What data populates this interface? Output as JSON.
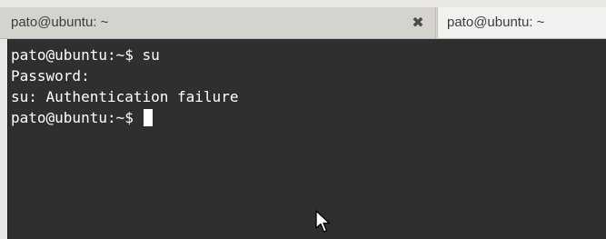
{
  "tabs": [
    {
      "label": "pato@ubuntu: ~"
    },
    {
      "label": "pato@ubuntu: ~"
    }
  ],
  "tab_close_icon": "close-icon",
  "terminal": {
    "lines": [
      "pato@ubuntu:~$ su",
      "Password:",
      "su: Authentication failure",
      "pato@ubuntu:~$ "
    ]
  },
  "colors": {
    "terminal_bg": "#2f2f2f",
    "terminal_fg": "#ffffff",
    "tabbar_bg": "#dcdad5"
  }
}
